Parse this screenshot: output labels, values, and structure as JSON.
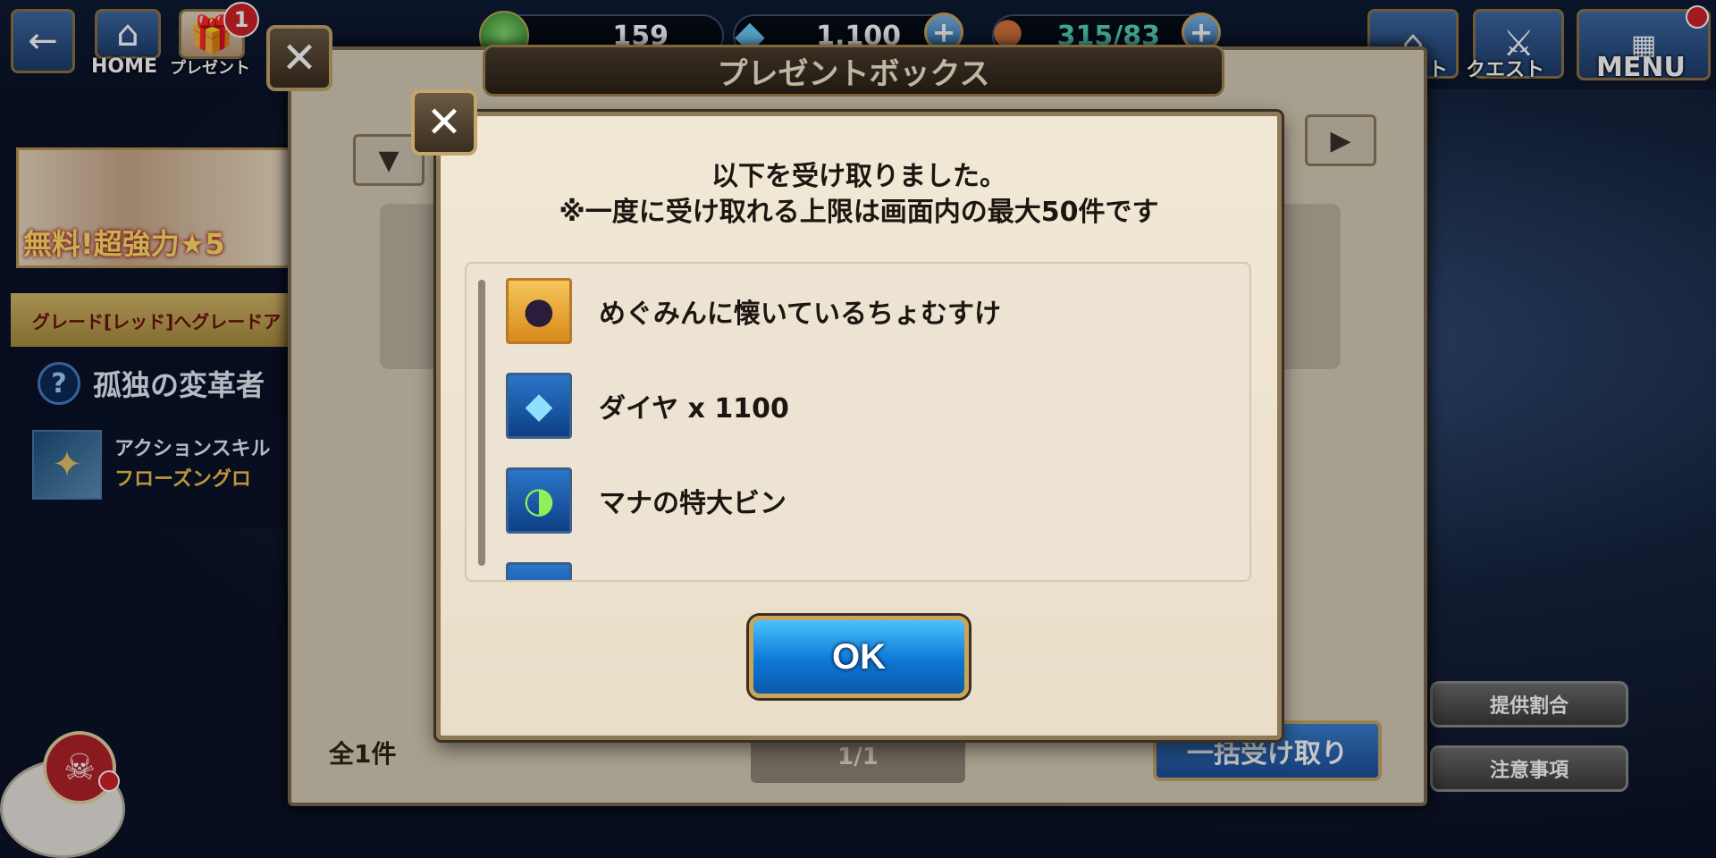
{
  "topbar": {
    "home_label": "HOME",
    "present_label": "プレゼント",
    "present_badge": "1",
    "gems_count": "159",
    "diamonds_count": "1,100",
    "stamina": "315/83",
    "right_label_1": "ト",
    "quest_label": "クエスト",
    "menu_label": "MENU"
  },
  "left_panel": {
    "banner_text": "無料!超強力★5",
    "grade_text": "グレード[レッド]へグレードア",
    "quest_title": "孤独の変革者",
    "skill_line1": "アクションスキル",
    "skill_line2": "フローズングロ"
  },
  "present_box": {
    "title": "プレゼントボックス",
    "count_text": "全1件",
    "page_text": "1/1",
    "bulk_button": "一括受け取り"
  },
  "side_buttons": {
    "rates": "提供割合",
    "notes": "注意事項"
  },
  "dialog": {
    "message_line1": "以下を受け取りました。",
    "message_line2": "※一度に受け取れる上限は画面内の最大50件です",
    "items": [
      {
        "label": "めぐみんに懐いているちょむすけ",
        "icon": "cat-icon"
      },
      {
        "label": "ダイヤ x 1100",
        "icon": "diamond-icon"
      },
      {
        "label": "マナの特大ビン",
        "icon": "mana-bottle-icon"
      }
    ],
    "ok_label": "OK"
  },
  "colors": {
    "ok_button": "#0d78d4",
    "dialog_bg": "#f1e8d6",
    "frame_gold": "#caa45a"
  }
}
